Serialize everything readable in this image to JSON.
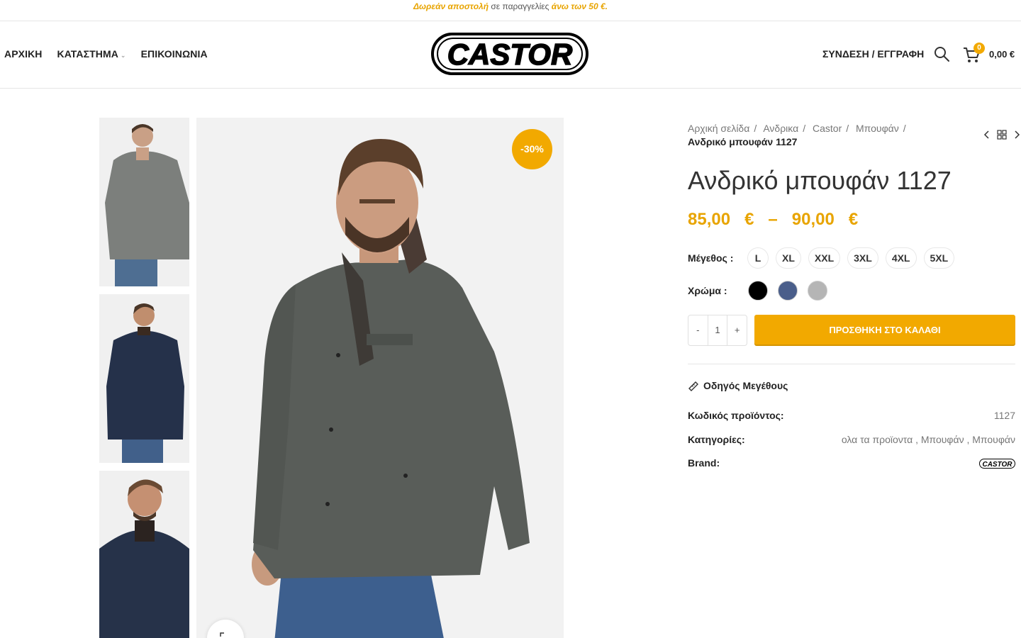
{
  "topbar": {
    "prefix_highlight": "Δωρεάν αποστολή",
    "middle": " σε παραγγελίες ",
    "suffix_highlight": "άνω των 50 €."
  },
  "header": {
    "nav": [
      {
        "label": "ΑΡΧΙΚΗ"
      },
      {
        "label": "ΚΑΤΑΣΤΗΜΑ"
      },
      {
        "label": "ΕΠΙΚΟΙΝΩΝΙΑ"
      }
    ],
    "logo_text": "CASTOR",
    "account_label": "ΣΥΝΔΕΣΗ / ΕΓΓΡΑΦΗ",
    "cart_count": "0",
    "cart_total": "0,00 €"
  },
  "gallery": {
    "sale_badge": "-30%",
    "thumbnails": [
      {
        "jacket_color": "#7a7d7a"
      },
      {
        "jacket_color": "#23304a"
      },
      {
        "jacket_color": "#243049"
      }
    ],
    "main_jacket_color": "#595d59"
  },
  "breadcrumb": {
    "items": [
      "Αρχική σελίδα",
      "Ανδρικα",
      "Castor",
      "Μπουφάν"
    ],
    "current": "Ανδρικό μπουφάν 1127"
  },
  "product": {
    "title": "Ανδρικό μπουφάν 1127",
    "price_range": "85,00   €   –   90,00   €",
    "size_label": "Μέγεθος :",
    "sizes": [
      "L",
      "XL",
      "XXL",
      "3XL",
      "4XL",
      "5XL"
    ],
    "color_label": "Χρώμα :",
    "colors": [
      "#000000",
      "#4a5e8a",
      "#b5b5b5"
    ],
    "qty_minus": "-",
    "qty_value": "1",
    "qty_plus": "+",
    "add_to_cart": "ΠΡΟΣΘΗΚΗ ΣΤΟ ΚΑΛΑΘΙ",
    "size_guide": "Οδηγός Μεγέθους",
    "meta": {
      "sku_label": "Κωδικός προϊόντος:",
      "sku_value": "1127",
      "categories_label": "Κατηγορίες:",
      "categories_value": "ολα τα προϊοντα , Μπουφάν , Μπουφάν",
      "brand_label": "Brand:"
    }
  },
  "colors": {
    "accent": "#f2a900",
    "text_dark": "#222222"
  }
}
